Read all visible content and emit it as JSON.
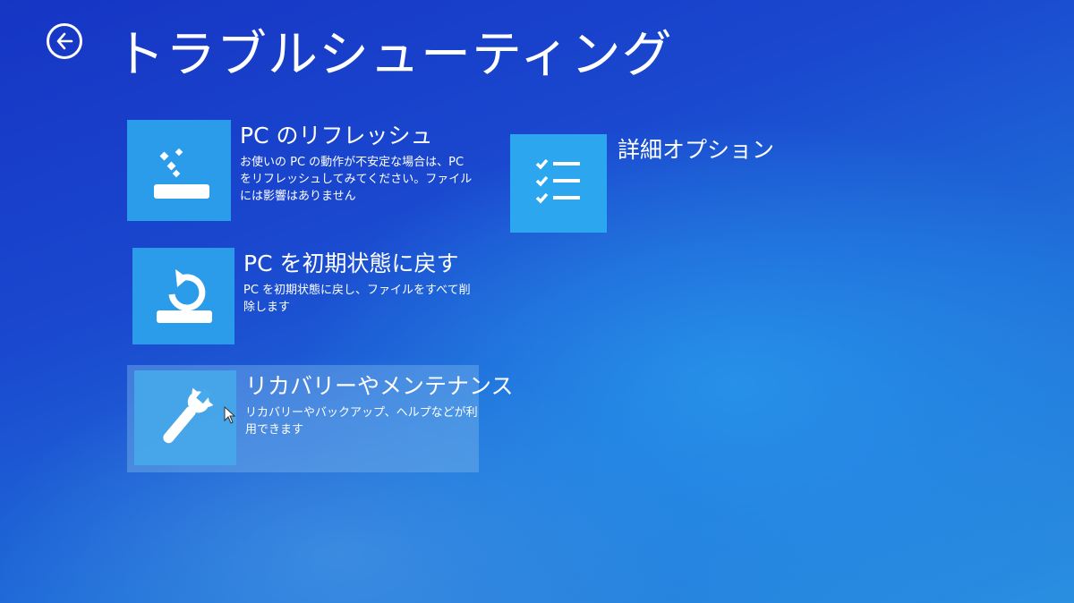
{
  "header": {
    "title": "トラブルシューティング"
  },
  "tiles": [
    {
      "title": "PC のリフレッシュ",
      "description": "お使いの PC の動作が不安定な場合は、PC をリフレッシュしてみてください。ファイルには影響はありません",
      "icon": "refresh-drive-icon"
    },
    {
      "title": "PC を初期状態に戻す",
      "description": "PC を初期状態に戻し、ファイルをすべて削除します",
      "icon": "reset-drive-icon"
    },
    {
      "title": "リカバリーやメンテナンス",
      "description": "リカバリーやバックアップ、ヘルプなどが利用できます",
      "icon": "wrench-icon"
    },
    {
      "title": "詳細オプション",
      "description": "",
      "icon": "checklist-icon"
    }
  ],
  "colors": {
    "background": "#1f5fd6",
    "tile": "#2b9cea",
    "text": "#ffffff"
  }
}
